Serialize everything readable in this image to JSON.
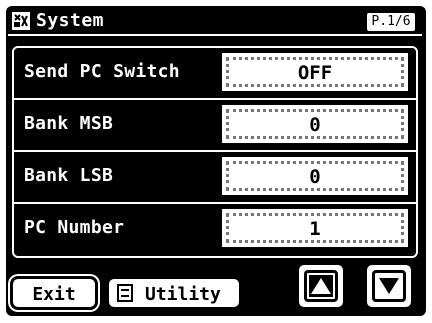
{
  "header": {
    "title": "System",
    "page_indicator": "P.1/6",
    "icon": "tools-icon"
  },
  "parameters": [
    {
      "label": "Send PC Switch",
      "value": "OFF"
    },
    {
      "label": "Bank MSB",
      "value": "0"
    },
    {
      "label": "Bank LSB",
      "value": "0"
    },
    {
      "label": "PC Number",
      "value": "1"
    }
  ],
  "footer": {
    "exit_label": "Exit",
    "utility_label": "Utility",
    "up_icon": "arrow-up-icon",
    "down_icon": "arrow-down-icon"
  },
  "colors": {
    "background": "#000000",
    "foreground": "#ffffff"
  }
}
